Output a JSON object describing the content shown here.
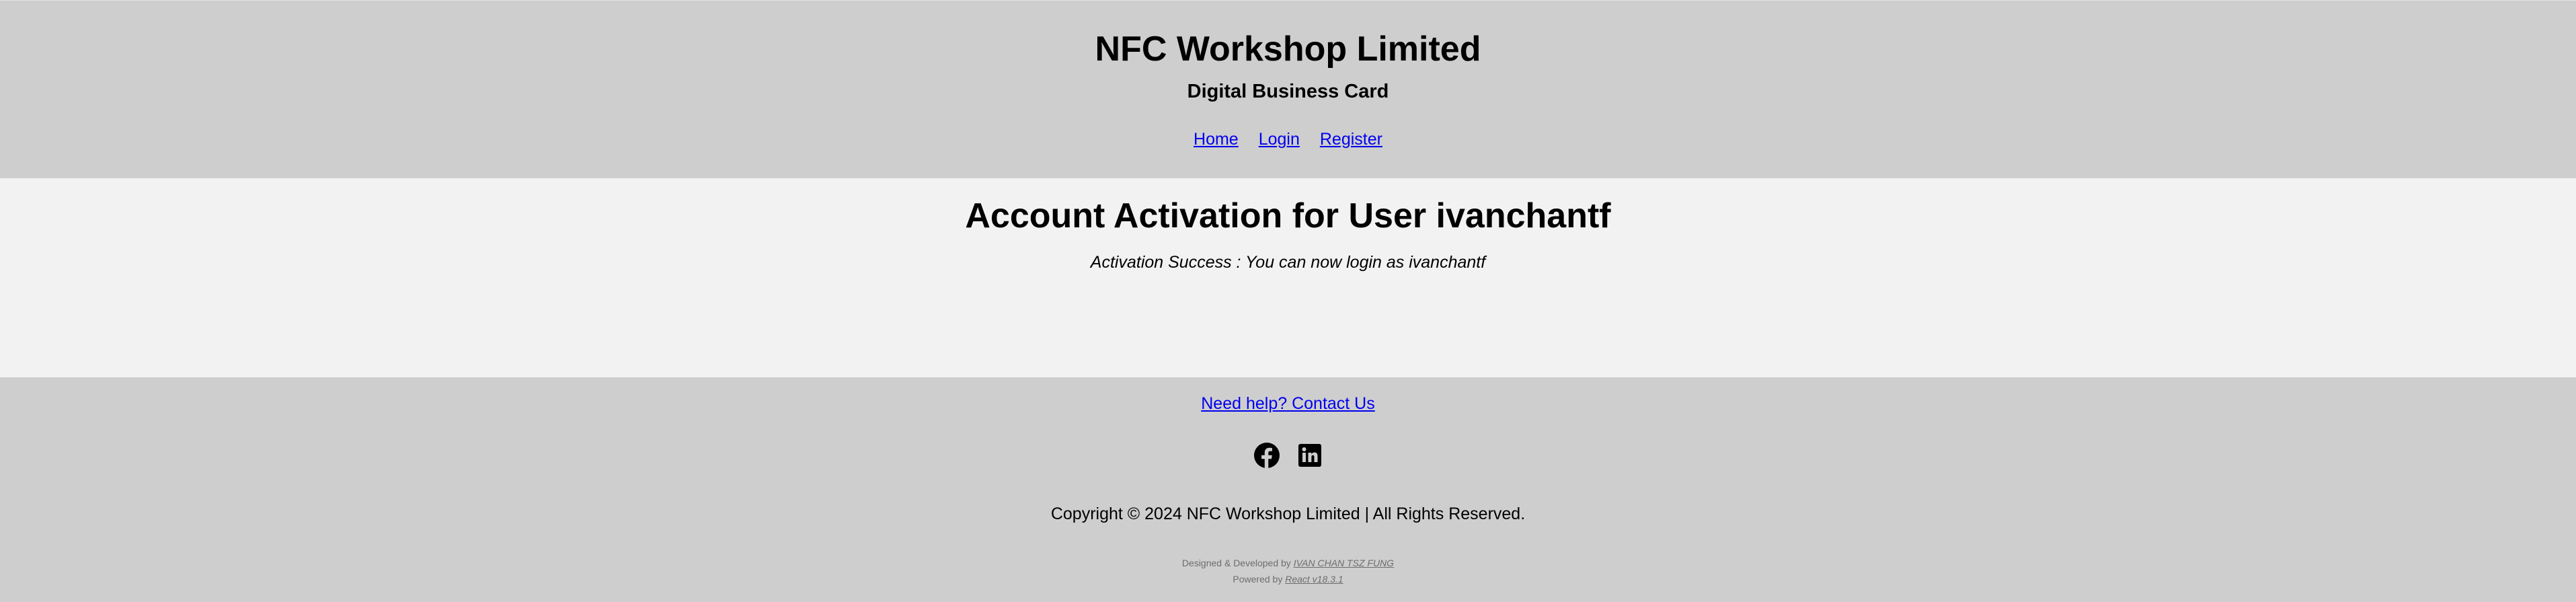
{
  "header": {
    "title": "NFC Workshop Limited",
    "subtitle": "Digital Business Card",
    "nav": {
      "home": "Home",
      "login": "Login",
      "register": "Register"
    }
  },
  "main": {
    "heading": "Account Activation for User ivanchantf",
    "message": "Activation Success : You can now login as ivanchantf"
  },
  "footer": {
    "contact_link": "Need help? Contact Us",
    "social_icons": [
      "facebook-icon",
      "linkedin-icon"
    ],
    "copyright": "Copyright © 2024 NFC Workshop Limited | All Rights Reserved.",
    "designed_prefix": "Designed & Developed by",
    "designer_link": "IVAN CHAN TSZ FUNG",
    "powered_prefix": "Powered by",
    "powered_link": "React v18.3.1"
  },
  "colors": {
    "header_bg": "#cecece",
    "body_bg": "#f2f2f2",
    "link": "#0000ee",
    "credits_text": "#6d6d6d"
  }
}
